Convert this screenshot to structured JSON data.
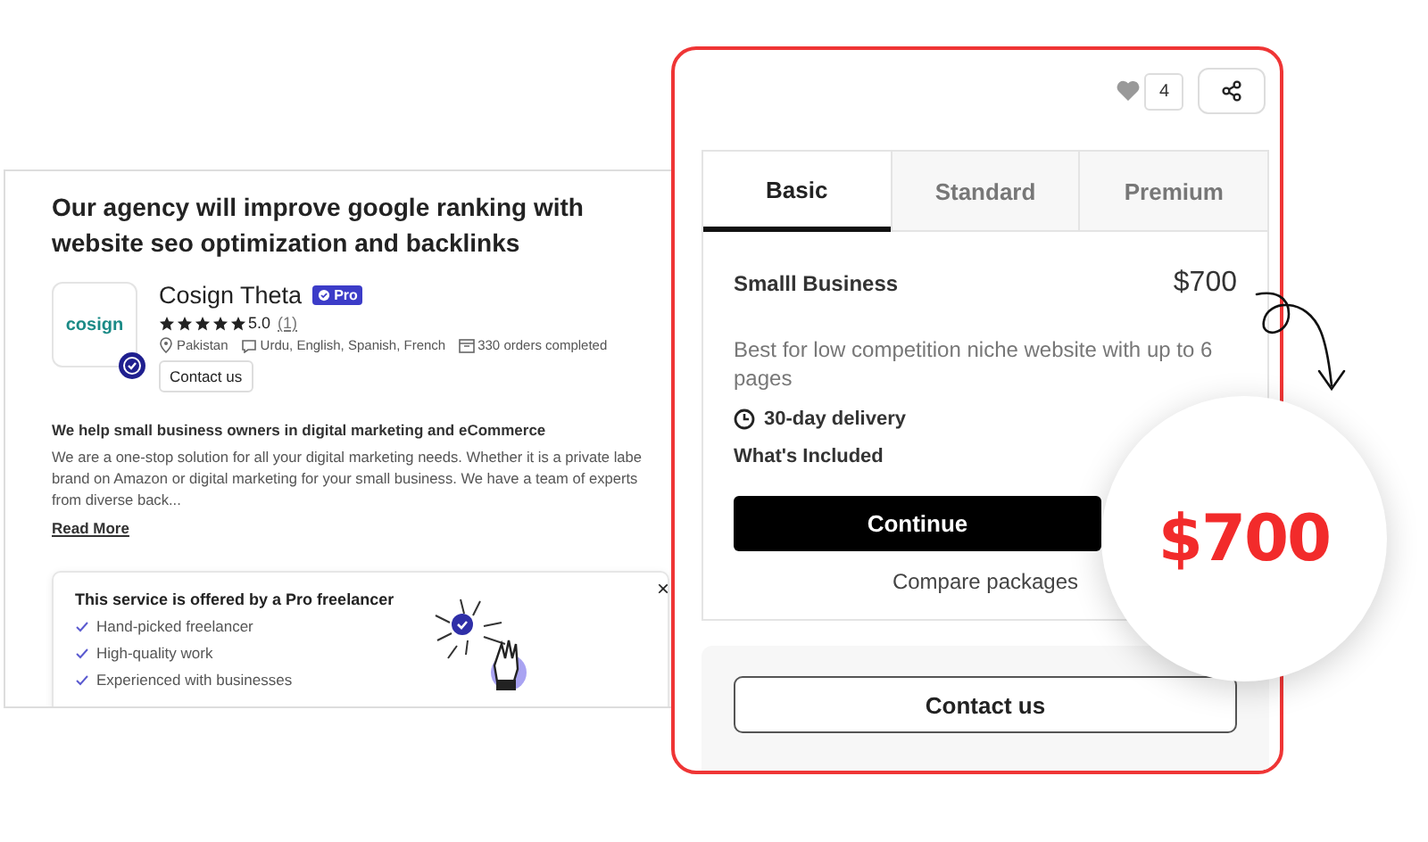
{
  "gig": {
    "title": "Our agency will improve google ranking with website seo optimization and backlinks",
    "seller": {
      "name": "Cosign Theta",
      "logo_text": "cosign",
      "badge": "Pro",
      "stars": 5,
      "rating": "5.0",
      "reviews": "(1)",
      "country": "Pakistan",
      "languages": "Urdu, English, Spanish, French",
      "orders": "330 orders completed",
      "contact_button": "Contact us"
    },
    "about": {
      "heading": "We help small business owners in digital marketing and eCommerce",
      "text": "We are a one-stop solution for all your digital marketing needs. Whether it is a private labe brand on Amazon or digital marketing for your small business. We have a team of experts from diverse back...",
      "read_more": "Read More"
    },
    "pro_notice": {
      "title": "This service is offered by a Pro freelancer",
      "close": "×",
      "items": [
        "Hand-picked freelancer",
        "High-quality work",
        "Experienced with businesses"
      ]
    }
  },
  "package_card": {
    "likes": "4",
    "tabs": [
      {
        "label": "Basic",
        "selected": true
      },
      {
        "label": "Standard",
        "selected": false
      },
      {
        "label": "Premium",
        "selected": false
      }
    ],
    "package": {
      "name": "Smalll Business",
      "price": "$700",
      "description": "Best for low competition niche website with up to 6 pages",
      "delivery": "30-day delivery",
      "included_heading": "What's Included"
    },
    "continue_button": "Continue",
    "compare_link": "Compare packages",
    "contact_button": "Contact us"
  },
  "callout": {
    "price": "$700"
  }
}
